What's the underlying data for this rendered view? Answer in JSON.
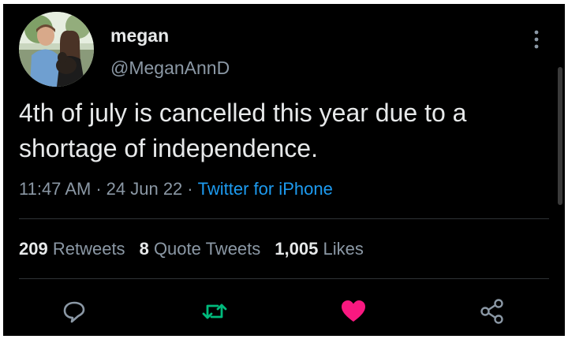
{
  "user": {
    "display_name": "megan",
    "handle": "@MeganAnnD",
    "avatar": "profile-photo"
  },
  "tweet": {
    "text": "4th of july is cancelled this year due to a shortage of independence.",
    "time": "11:47 AM",
    "date": "24 Jun 22",
    "source": "Twitter for iPhone",
    "separator": "·"
  },
  "stats": {
    "retweets_count": "209",
    "retweets_label": "Retweets",
    "quotes_count": "8",
    "quotes_label": "Quote Tweets",
    "likes_count": "1,005",
    "likes_label": "Likes"
  },
  "actions": {
    "reply_icon": "reply-icon",
    "retweet_icon": "retweet-icon",
    "like_icon": "heart-icon",
    "share_icon": "share-icon"
  },
  "colors": {
    "background": "#000000",
    "primary_text": "#e7e9ea",
    "secondary_text": "#8b98a5",
    "link": "#1d9bf0",
    "retweet": "#00ba7c",
    "like": "#f91880"
  }
}
